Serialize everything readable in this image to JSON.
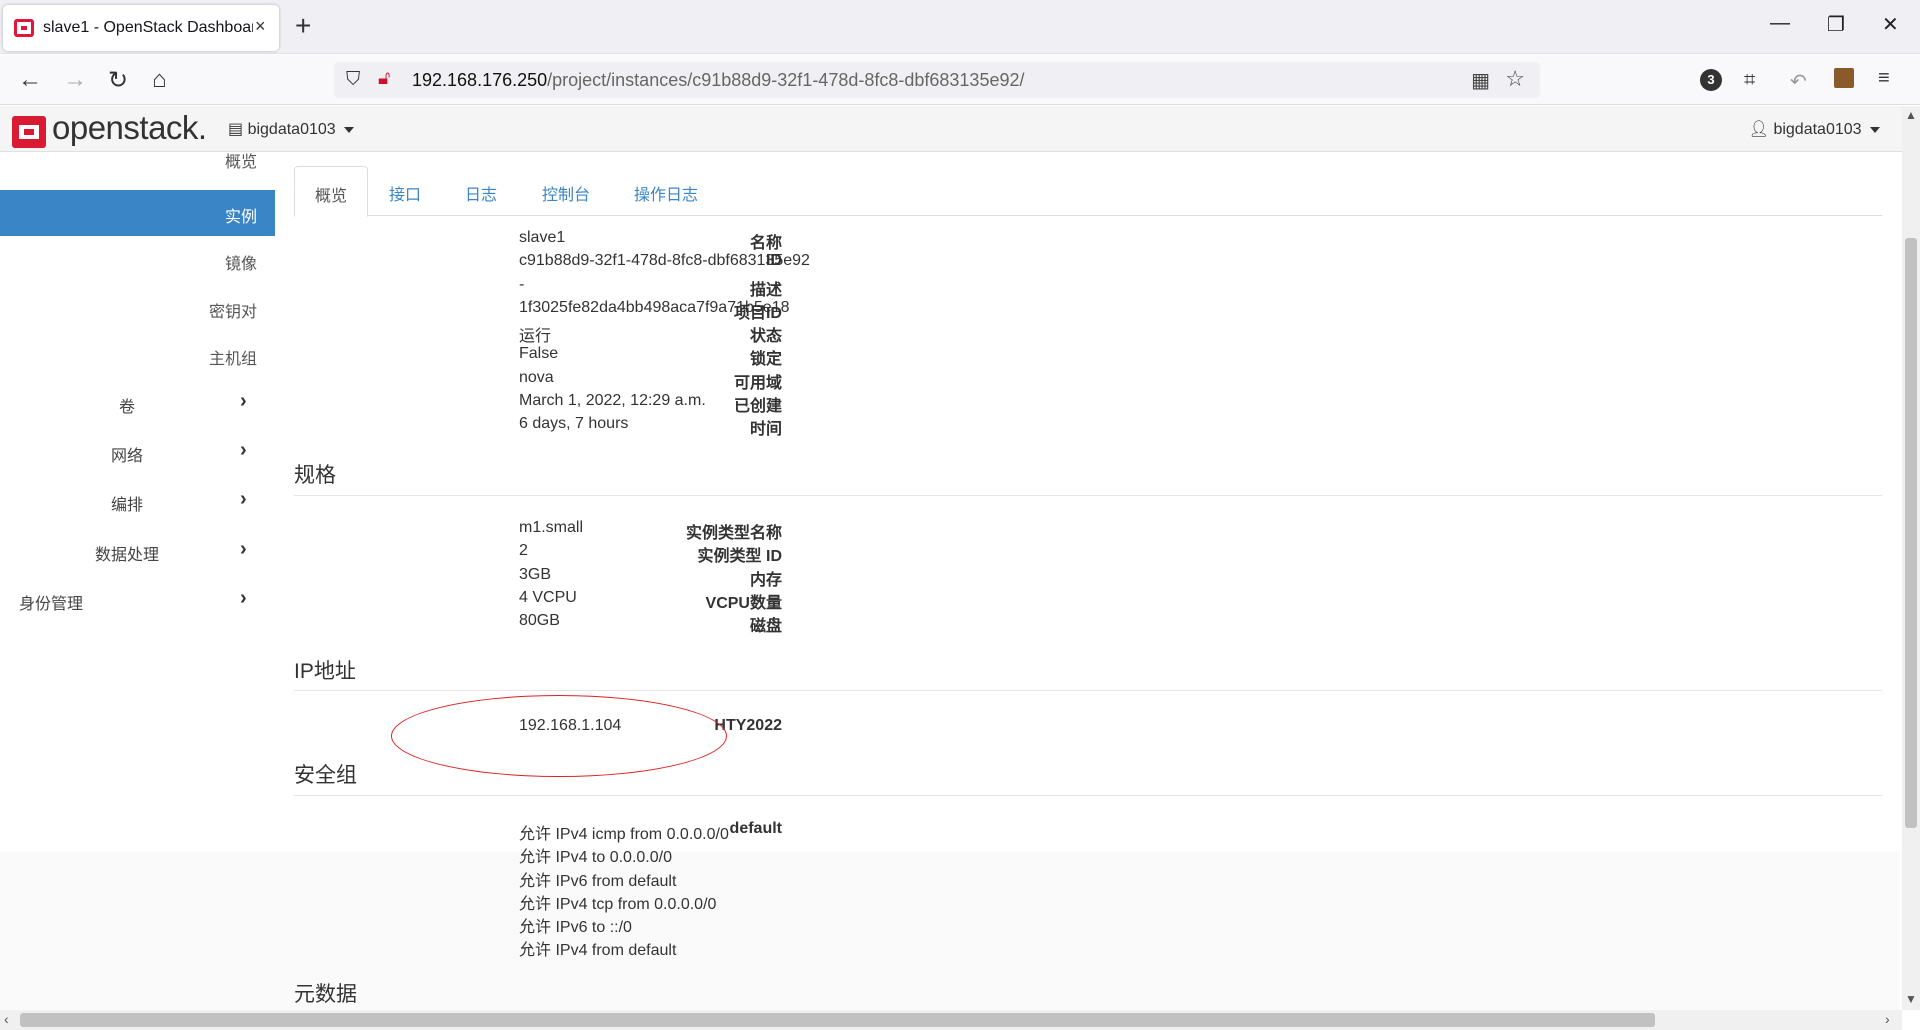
{
  "browser": {
    "tab_title": "slave1 - OpenStack Dashboard",
    "tab_close": "×",
    "new_tab": "+",
    "url_host": "192.168.176.250",
    "url_path": "/project/instances/c91b88d9-32f1-478d-8fc8-dbf683135e92/",
    "extension_badge": "3",
    "win_minimize": "—",
    "win_restore": "❐",
    "win_close": "✕"
  },
  "header": {
    "logo_text": "openstack.",
    "project": "bigdata0103",
    "user": "bigdata0103"
  },
  "sidebar": {
    "items": [
      {
        "label": "概览",
        "active": false
      },
      {
        "label": "实例",
        "active": true
      },
      {
        "label": "镜像",
        "active": false
      },
      {
        "label": "密钥对",
        "active": false
      },
      {
        "label": "主机组",
        "active": false
      }
    ],
    "groups": [
      {
        "label": "卷"
      },
      {
        "label": "网络"
      },
      {
        "label": "编排"
      },
      {
        "label": "数据处理"
      },
      {
        "label": "身份管理"
      }
    ]
  },
  "tabs": [
    {
      "label": "概览",
      "active": true
    },
    {
      "label": "接口",
      "active": false
    },
    {
      "label": "日志",
      "active": false
    },
    {
      "label": "控制台",
      "active": false
    },
    {
      "label": "操作日志",
      "active": false
    }
  ],
  "overview": [
    {
      "k": "名称",
      "v": "slave1"
    },
    {
      "k": "ID",
      "v": "c91b88d9-32f1-478d-8fc8-dbf683135e92"
    },
    {
      "k": "描述",
      "v": "-"
    },
    {
      "k": "项目ID",
      "v": "1f3025fe82da4bb498aca7f9a71b5e18"
    },
    {
      "k": "状态",
      "v": "运行"
    },
    {
      "k": "锁定",
      "v": "False"
    },
    {
      "k": "可用域",
      "v": "nova"
    },
    {
      "k": "已创建",
      "v": "March 1, 2022, 12:29 a.m."
    },
    {
      "k": "时间",
      "v": "6 days, 7 hours"
    }
  ],
  "spec_title": "规格",
  "spec": [
    {
      "k": "实例类型名称",
      "v": "m1.small"
    },
    {
      "k": "实例类型 ID",
      "v": "2"
    },
    {
      "k": "内存",
      "v": "3GB"
    },
    {
      "k": "VCPU数量",
      "v": "4 VCPU"
    },
    {
      "k": "磁盘",
      "v": "80GB"
    }
  ],
  "ip_title": "IP地址",
  "ip": {
    "k": "HTY2022",
    "v": "192.168.1.104"
  },
  "secgroup_title": "安全组",
  "secgroup": {
    "k": "default",
    "rules": [
      "允许 IPv4 icmp from 0.0.0.0/0",
      "允许 IPv4 to 0.0.0.0/0",
      "允许 IPv6 from default",
      "允许 IPv4 tcp from 0.0.0.0/0",
      "允许 IPv6 to ::/0",
      "允许 IPv4 from default"
    ]
  },
  "metadata_title": "元数据",
  "colors": {
    "accent": "#3a85c6",
    "brand": "#da1a32",
    "highlight": "#e02020"
  }
}
